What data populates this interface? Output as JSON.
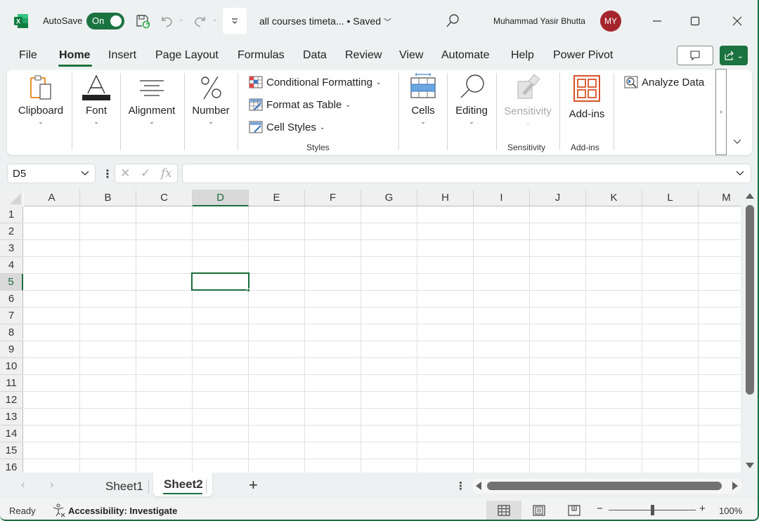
{
  "titlebar": {
    "autosave_label": "AutoSave",
    "autosave_state": "On",
    "doc_title": "all courses timeta...",
    "save_status": "• Saved",
    "user_name": "Muhammad Yasir Bhutta",
    "user_initials": "MY",
    "avatar_color": "#a4262c"
  },
  "tabs": [
    "File",
    "Home",
    "Insert",
    "Page Layout",
    "Formulas",
    "Data",
    "Review",
    "View",
    "Automate",
    "Help",
    "Power Pivot"
  ],
  "active_tab": "Home",
  "ribbon": {
    "clipboard": "Clipboard",
    "font": "Font",
    "alignment": "Alignment",
    "number": "Number",
    "conditional_formatting": "Conditional Formatting",
    "format_as_table": "Format as Table",
    "cell_styles": "Cell Styles",
    "styles_group": "Styles",
    "cells": "Cells",
    "editing": "Editing",
    "sensitivity": "Sensitivity",
    "sensitivity_group": "Sensitivity",
    "addins": "Add-ins",
    "addins_group": "Add-ins",
    "analyze_data": "Analyze Data",
    "more_glyph": "›"
  },
  "formula_bar": {
    "name_box": "D5",
    "formula": "",
    "fx": "fx"
  },
  "grid": {
    "columns": [
      "A",
      "B",
      "C",
      "D",
      "E",
      "F",
      "G",
      "H",
      "I",
      "J",
      "K",
      "L",
      "M"
    ],
    "rows": [
      "1",
      "2",
      "3",
      "4",
      "5",
      "6",
      "7",
      "8",
      "9",
      "10",
      "11",
      "12",
      "13",
      "14",
      "15",
      "16"
    ],
    "selected_column": "D",
    "selected_row": "5",
    "accent_color": "#1b6e3b"
  },
  "sheets": {
    "tabs": [
      "Sheet1",
      "Sheet2"
    ],
    "active": "Sheet2",
    "add_label": "+"
  },
  "status": {
    "ready": "Ready",
    "accessibility": "Accessibility: Investigate",
    "zoom": "100%",
    "zoom_minus": "−",
    "zoom_plus": "+"
  }
}
